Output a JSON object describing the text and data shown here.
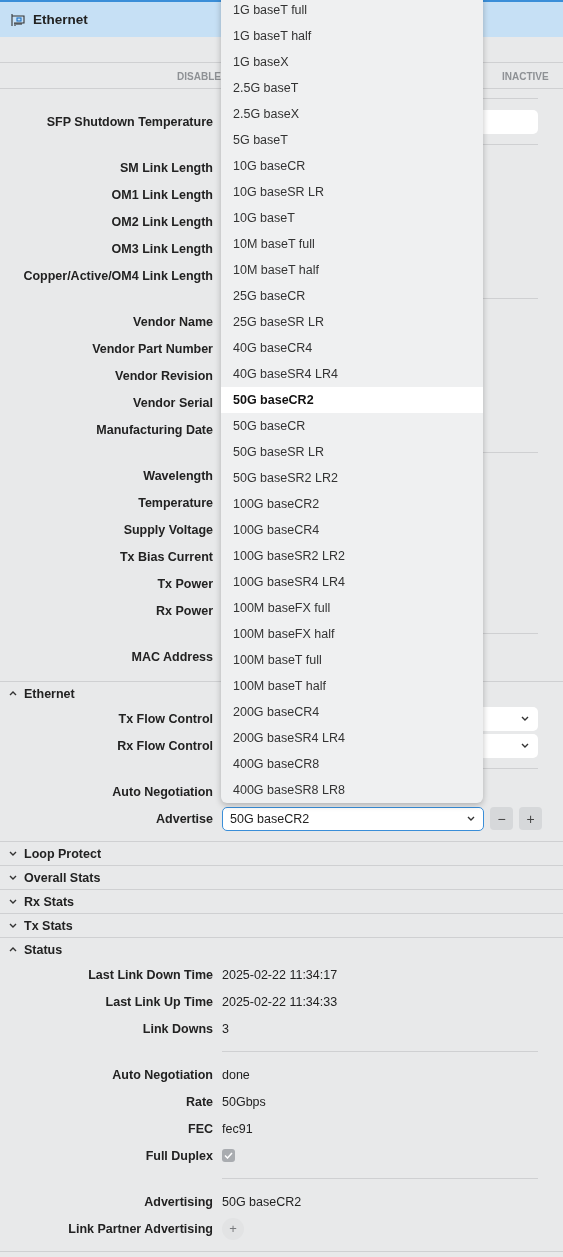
{
  "header": {
    "title": "Ethernet"
  },
  "status_strip": [
    "DISABLE",
    "INACTIVE"
  ],
  "top_groups": [
    [
      {
        "label": "SFP Shutdown Temperature",
        "kind": "field"
      }
    ],
    [
      {
        "label": "SM Link Length",
        "kind": "none"
      },
      {
        "label": "OM1 Link Length",
        "kind": "none"
      },
      {
        "label": "OM2 Link Length",
        "kind": "none"
      },
      {
        "label": "OM3 Link Length",
        "kind": "none"
      },
      {
        "label": "Copper/Active/OM4 Link Length",
        "kind": "none"
      }
    ],
    [
      {
        "label": "Vendor Name",
        "kind": "none"
      },
      {
        "label": "Vendor Part Number",
        "kind": "none"
      },
      {
        "label": "Vendor Revision",
        "kind": "none"
      },
      {
        "label": "Vendor Serial",
        "kind": "none"
      },
      {
        "label": "Manufacturing Date",
        "kind": "none"
      }
    ],
    [
      {
        "label": "Wavelength",
        "kind": "none"
      },
      {
        "label": "Temperature",
        "kind": "none"
      },
      {
        "label": "Supply Voltage",
        "kind": "none"
      },
      {
        "label": "Tx Bias Current",
        "kind": "none"
      },
      {
        "label": "Tx Power",
        "kind": "none"
      },
      {
        "label": "Rx Power",
        "kind": "none"
      }
    ],
    [
      {
        "label": "MAC Address",
        "kind": "none"
      }
    ]
  ],
  "sections": [
    {
      "title": "Ethernet",
      "expanded": true,
      "groups": [
        [
          {
            "label": "Tx Flow Control",
            "kind": "select"
          },
          {
            "label": "Rx Flow Control",
            "kind": "select"
          }
        ],
        [
          {
            "label": "Auto Negotiation",
            "kind": "none"
          },
          {
            "label": "Advertise",
            "kind": "select",
            "value": "50G baseCR2",
            "focused": true,
            "buttons": [
              "−",
              "+"
            ]
          }
        ]
      ]
    },
    {
      "title": "Loop Protect",
      "expanded": false
    },
    {
      "title": "Overall Stats",
      "expanded": false
    },
    {
      "title": "Rx Stats",
      "expanded": false
    },
    {
      "title": "Tx Stats",
      "expanded": false
    },
    {
      "title": "Status",
      "expanded": true,
      "groups": [
        [
          {
            "label": "Last Link Down Time",
            "kind": "text",
            "value": "2025-02-22 11:34:17"
          },
          {
            "label": "Last Link Up Time",
            "kind": "text",
            "value": "2025-02-22 11:34:33"
          },
          {
            "label": "Link Downs",
            "kind": "text",
            "value": "3"
          }
        ],
        [
          {
            "label": "Auto Negotiation",
            "kind": "text",
            "value": "done"
          },
          {
            "label": "Rate",
            "kind": "text",
            "value": "50Gbps"
          },
          {
            "label": "FEC",
            "kind": "text",
            "value": "fec91"
          },
          {
            "label": "Full Duplex",
            "kind": "checkbox",
            "checked": true,
            "disabled": true
          }
        ],
        [
          {
            "label": "Advertising",
            "kind": "text",
            "value": "50G baseCR2"
          },
          {
            "label": "Link Partner Advertising",
            "kind": "add",
            "button": "+",
            "disabled": true
          }
        ]
      ]
    }
  ],
  "dropdown": {
    "options": [
      {
        "label": "1G baseT full",
        "selected": false
      },
      {
        "label": "1G baseT half",
        "selected": false
      },
      {
        "label": "1G baseX",
        "selected": false
      },
      {
        "label": "2.5G baseT",
        "selected": false
      },
      {
        "label": "2.5G baseX",
        "selected": false
      },
      {
        "label": "5G baseT",
        "selected": false
      },
      {
        "label": "10G baseCR",
        "selected": false
      },
      {
        "label": "10G baseSR LR",
        "selected": false
      },
      {
        "label": "10G baseT",
        "selected": false
      },
      {
        "label": "10M baseT full",
        "selected": false
      },
      {
        "label": "10M baseT half",
        "selected": false
      },
      {
        "label": "25G baseCR",
        "selected": false
      },
      {
        "label": "25G baseSR LR",
        "selected": false
      },
      {
        "label": "40G baseCR4",
        "selected": false
      },
      {
        "label": "40G baseSR4 LR4",
        "selected": false
      },
      {
        "label": "50G baseCR2",
        "selected": true
      },
      {
        "label": "50G baseCR",
        "selected": false
      },
      {
        "label": "50G baseSR LR",
        "selected": false
      },
      {
        "label": "50G baseSR2 LR2",
        "selected": false
      },
      {
        "label": "100G baseCR2",
        "selected": false
      },
      {
        "label": "100G baseCR4",
        "selected": false
      },
      {
        "label": "100G baseSR2 LR2",
        "selected": false
      },
      {
        "label": "100G baseSR4 LR4",
        "selected": false
      },
      {
        "label": "100M baseFX full",
        "selected": false
      },
      {
        "label": "100M baseFX half",
        "selected": false
      },
      {
        "label": "100M baseT full",
        "selected": false
      },
      {
        "label": "100M baseT half",
        "selected": false
      },
      {
        "label": "200G baseCR4",
        "selected": false
      },
      {
        "label": "200G baseSR4 LR4",
        "selected": false
      },
      {
        "label": "400G baseCR8",
        "selected": false
      },
      {
        "label": "400G baseSR8 LR8",
        "selected": false
      }
    ]
  }
}
